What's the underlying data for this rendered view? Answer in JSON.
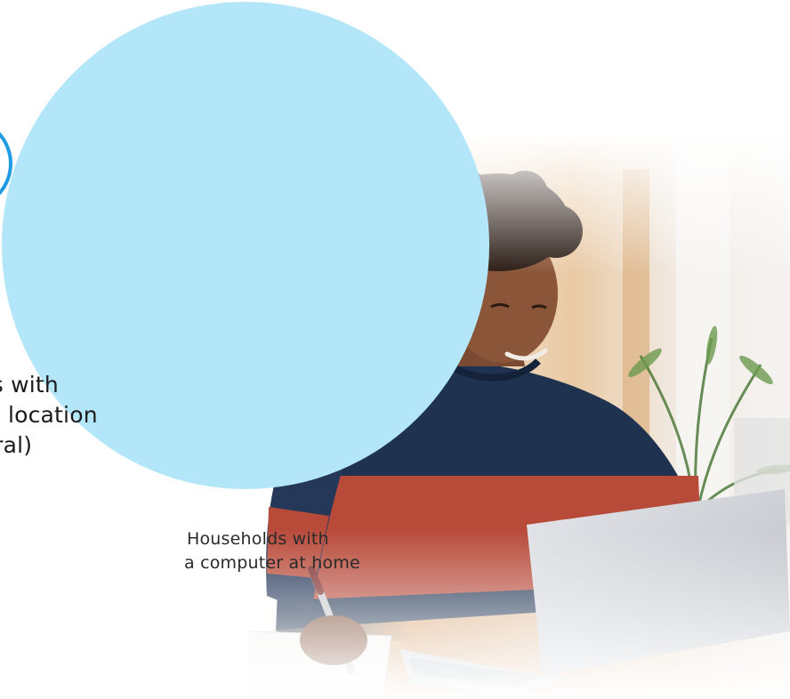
{
  "headline": {
    "line1": "holds with",
    "line2": "et by location",
    "line3": "n/Rural)"
  },
  "caption": {
    "line1": "Households with",
    "line2": "a computer at home"
  },
  "colors": {
    "circle": "#b4e6f9",
    "ring": "#1e9be3",
    "sweater_navy": "#1f3350",
    "sweater_red": "#b84a3a",
    "laptop": "#c9ccd1"
  },
  "image": {
    "subject": "student-using-laptop-photo"
  }
}
